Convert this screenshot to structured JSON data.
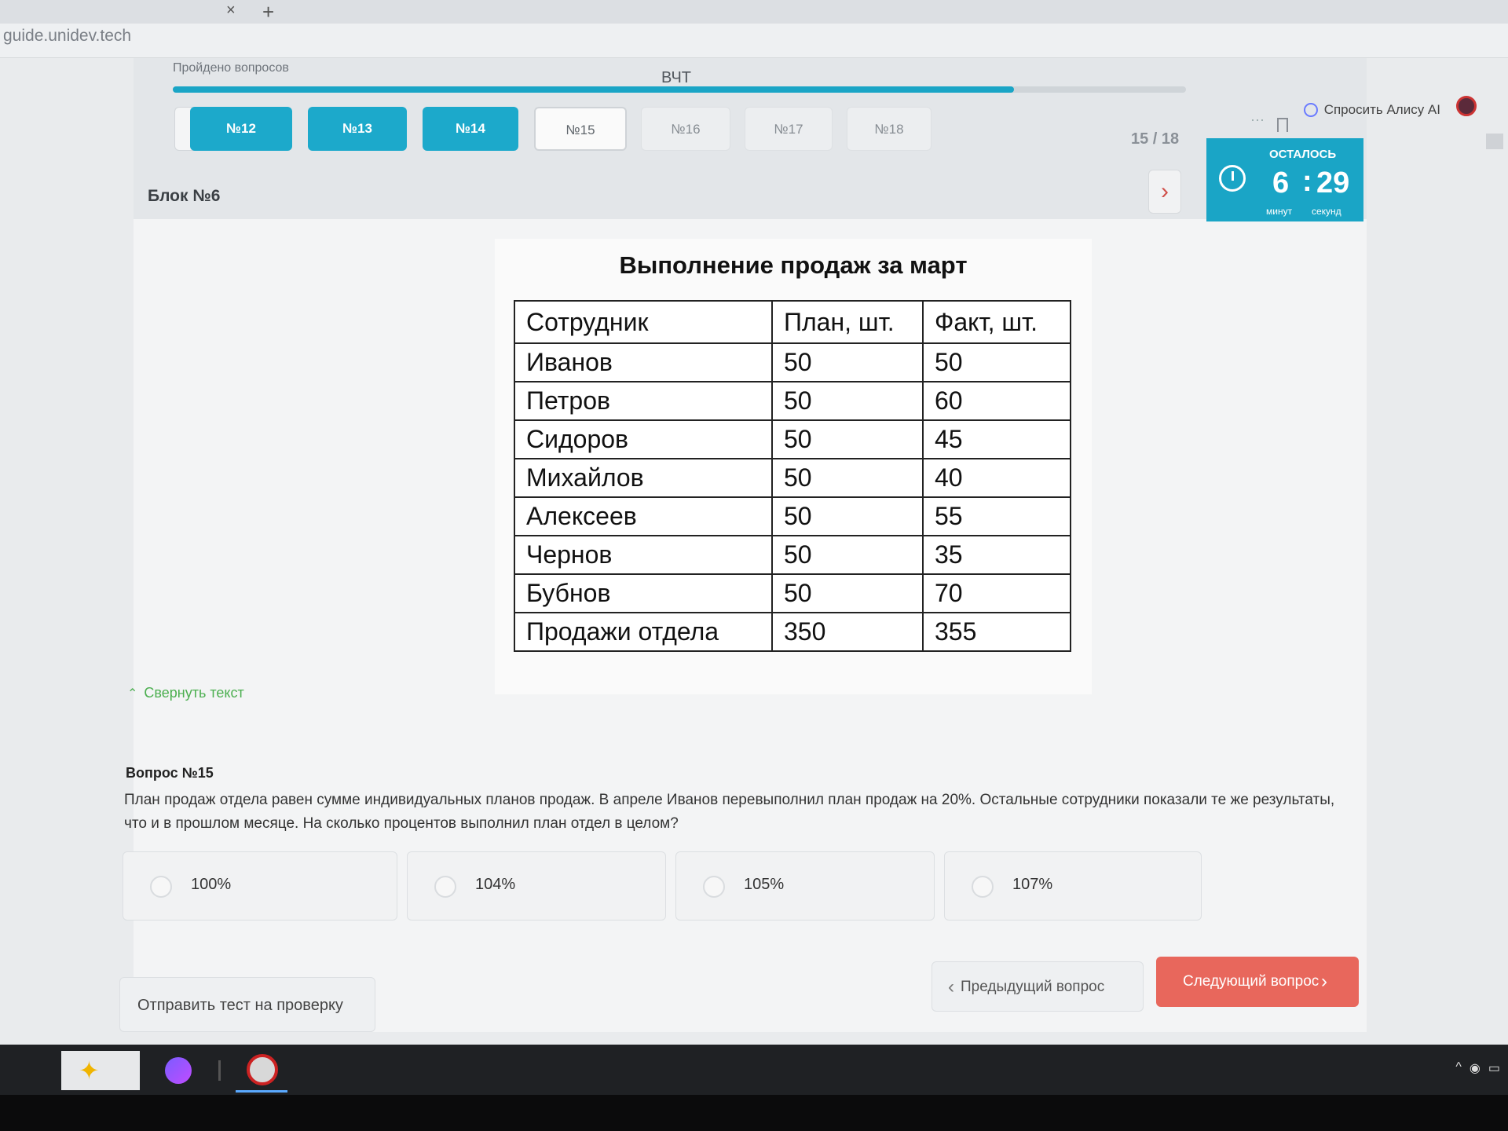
{
  "browser": {
    "url": "guide.unidev.tech",
    "tab_close": "×",
    "tab_new": "+",
    "menu_dots": "···",
    "alice_label": "Спросить Алису AI"
  },
  "header": {
    "passed_label": "Пройдено вопросов",
    "test_name": "ВЧТ",
    "progress_count": "15 / 18",
    "progress_fraction": 0.83,
    "nav_prev": "‹",
    "nav_next": "›",
    "questions": [
      {
        "label": "№12",
        "state": "done"
      },
      {
        "label": "№13",
        "state": "done"
      },
      {
        "label": "№14",
        "state": "done"
      },
      {
        "label": "№15",
        "state": "current"
      },
      {
        "label": "№16",
        "state": "todo"
      },
      {
        "label": "№17",
        "state": "todo"
      },
      {
        "label": "№18",
        "state": "todo"
      }
    ]
  },
  "timer": {
    "label": "ОСТАЛОСЬ",
    "minutes": "6",
    "colon": ":",
    "seconds": "29",
    "minutes_label": "минут",
    "seconds_label": "секунд"
  },
  "block": {
    "title": "Блок №6"
  },
  "figure": {
    "title": "Выполнение продаж за март",
    "headers": [
      "Сотрудник",
      "План, шт.",
      "Факт, шт."
    ],
    "rows": [
      [
        "Иванов",
        "50",
        "50"
      ],
      [
        "Петров",
        "50",
        "60"
      ],
      [
        "Сидоров",
        "50",
        "45"
      ],
      [
        "Михайлов",
        "50",
        "40"
      ],
      [
        "Алексеев",
        "50",
        "55"
      ],
      [
        "Чернов",
        "50",
        "35"
      ],
      [
        "Бубнов",
        "50",
        "70"
      ],
      [
        "Продажи отдела",
        "350",
        "355"
      ]
    ],
    "collapse_label": "Свернуть текст"
  },
  "question": {
    "title": "Вопрос №15",
    "text": "План продаж отдела равен сумме индивидуальных планов продаж. В апреле Иванов перевыполнил план продаж на 20%. Остальные сотрудники показали те же результаты, что и в прошлом месяце. На сколько процентов выполнил план отдел в целом?",
    "options": [
      "100%",
      "104%",
      "105%",
      "107%"
    ]
  },
  "footer": {
    "submit_label": "Отправить тест на проверку",
    "prev_label": "Предыдущий вопрос",
    "next_label": "Следующий вопрос",
    "prev_chev": "‹",
    "next_chev": "›"
  },
  "colors": {
    "accent": "#1aa5c6",
    "next_button": "#e8675c",
    "collapse_link": "#4caf50"
  }
}
